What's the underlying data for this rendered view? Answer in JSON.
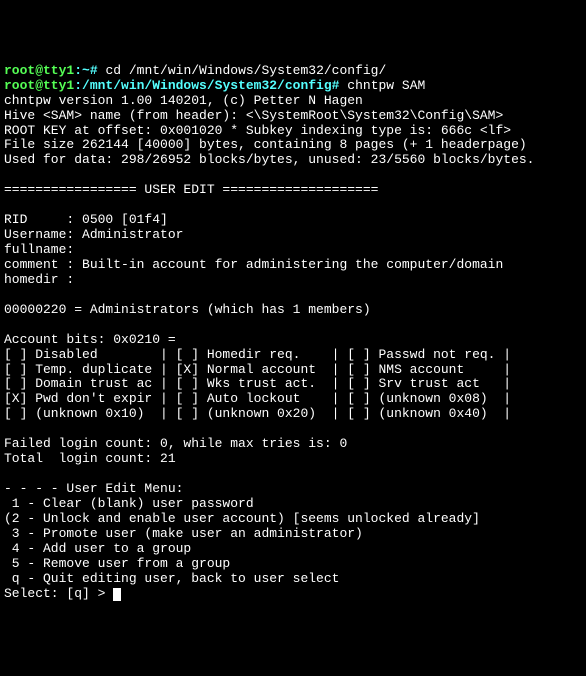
{
  "line1": {
    "prompt_pre": "root@tty1",
    "prompt_path": ":~",
    "hash": "#",
    "cmd": " cd /mnt/win/Windows/System32/config/"
  },
  "line2": {
    "prompt_pre": "root@tty1",
    "prompt_path": ":/mnt/win/Windows/System32/config",
    "hash": "#",
    "cmd": " chntpw SAM"
  },
  "version": "chntpw version 1.00 140201, (c) Petter N Hagen",
  "hive": "Hive <SAM> name (from header): <\\SystemRoot\\System32\\Config\\SAM>",
  "rootkey": "ROOT KEY at offset: 0x001020 * Subkey indexing type is: 666c <lf>",
  "filesize": "File size 262144 [40000] bytes, containing 8 pages (+ 1 headerpage)",
  "usedfor": "Used for data: 298/26952 blocks/bytes, unused: 23/5560 blocks/bytes.",
  "sep": "================= USER EDIT ====================",
  "rid": "RID     : 0500 [01f4]",
  "username": "Username: Administrator",
  "fullname": "fullname:",
  "comment": "comment : Built-in account for administering the computer/domain",
  "homedir": "homedir :",
  "mem": "00000220 = Administrators (which has 1 members)",
  "bits_header": "Account bits: 0x0210 =",
  "bits1": "[ ] Disabled        | [ ] Homedir req.    | [ ] Passwd not req. |",
  "bits2": "[ ] Temp. duplicate | [X] Normal account  | [ ] NMS account     |",
  "bits3": "[ ] Domain trust ac | [ ] Wks trust act.  | [ ] Srv trust act   |",
  "bits4": "[X] Pwd don't expir | [ ] Auto lockout    | [ ] (unknown 0x08)  |",
  "bits5": "[ ] (unknown 0x10)  | [ ] (unknown 0x20)  | [ ] (unknown 0x40)  |",
  "failed": "Failed login count: 0, while max tries is: 0",
  "total": "Total  login count: 21",
  "menu_header": "- - - - User Edit Menu:",
  "menu1": " 1 - Clear (blank) user password",
  "menu2": "(2 - Unlock and enable user account) [seems unlocked already]",
  "menu3": " 3 - Promote user (make user an administrator)",
  "menu4": " 4 - Add user to a group",
  "menu5": " 5 - Remove user from a group",
  "menuq": " q - Quit editing user, back to user select",
  "select_prompt": "Select: [q] > "
}
